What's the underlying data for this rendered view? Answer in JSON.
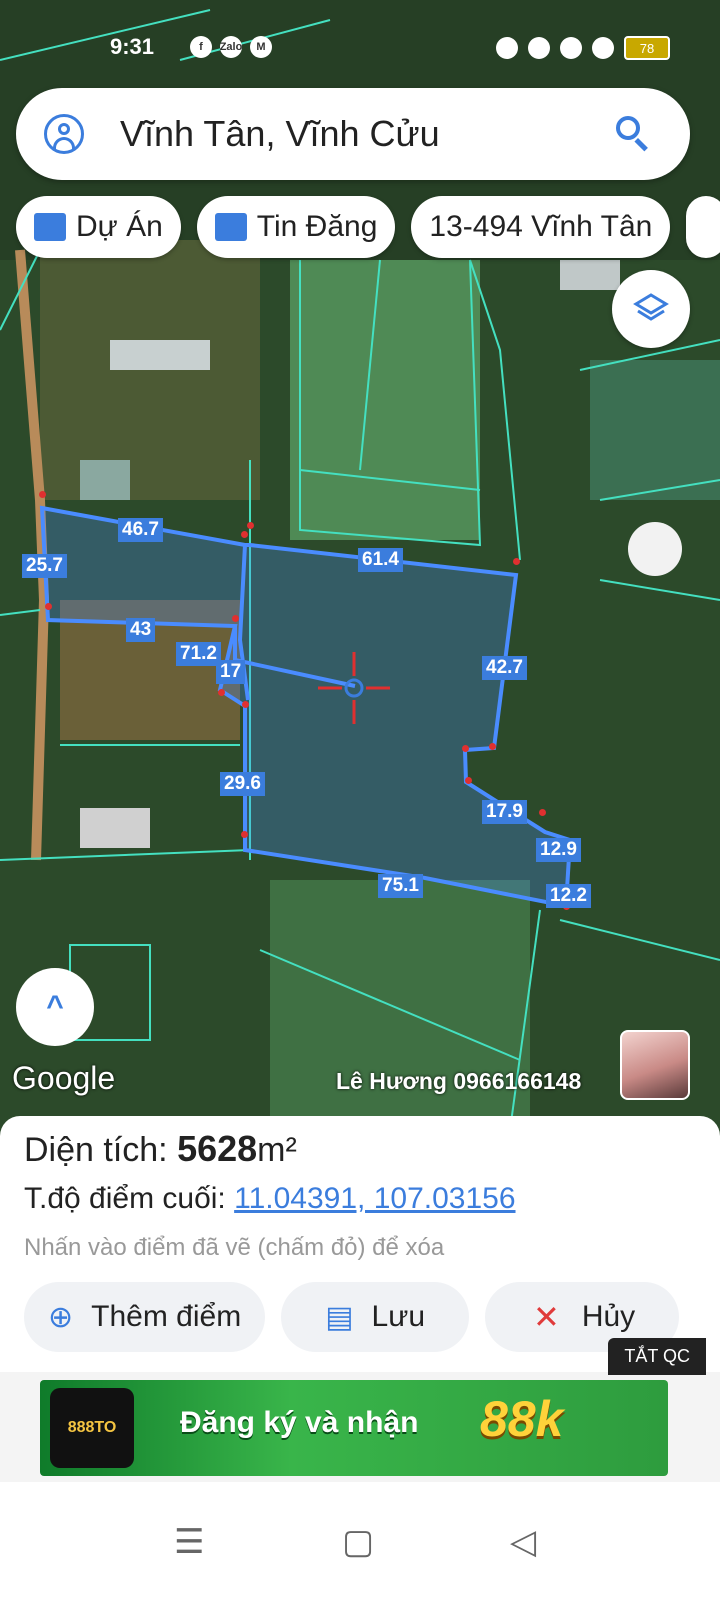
{
  "status_bar": {
    "time": "9:31",
    "notif_icons": [
      "facebook-icon",
      "zalo-icon",
      "gmail-icon"
    ],
    "zalo_label": "Zalo",
    "battery": "78"
  },
  "search": {
    "query": "Vĩnh Tân, Vĩnh Cửu"
  },
  "chips": [
    {
      "label": "Dự Án",
      "icon": "building-icon"
    },
    {
      "label": "Tin Đăng",
      "icon": "calendar-icon"
    },
    {
      "label": "13-494 Vĩnh Tân"
    }
  ],
  "map": {
    "edge_labels": [
      "46.7",
      "61.4",
      "25.7",
      "43",
      "71.2",
      "17",
      "42.7",
      "29.6",
      "17.9",
      "12.9",
      "75.1",
      "12.2"
    ],
    "watermark": "Google",
    "contact": "Lê Hương 0966166148"
  },
  "sheet": {
    "area_label": "Diện tích:",
    "area_value": "5628",
    "area_unit": "m²",
    "coord_label": "T.độ điểm cuối:",
    "coord_value": "11.04391, 107.03156",
    "hint": "Nhấn vào điểm đã vẽ (chấm đỏ) để xóa",
    "buttons": {
      "add": "Thêm điểm",
      "save": "Lưu",
      "cancel": "Hủy"
    }
  },
  "ad": {
    "close": "TẮT QC",
    "text": "Đăng ký và nhận",
    "amount": "88k",
    "brand": "888TO"
  },
  "colors": {
    "accent": "#3b7ddd",
    "parcel": "#4a8cff",
    "boundary": "#44e0c0",
    "point": "#e03030"
  }
}
